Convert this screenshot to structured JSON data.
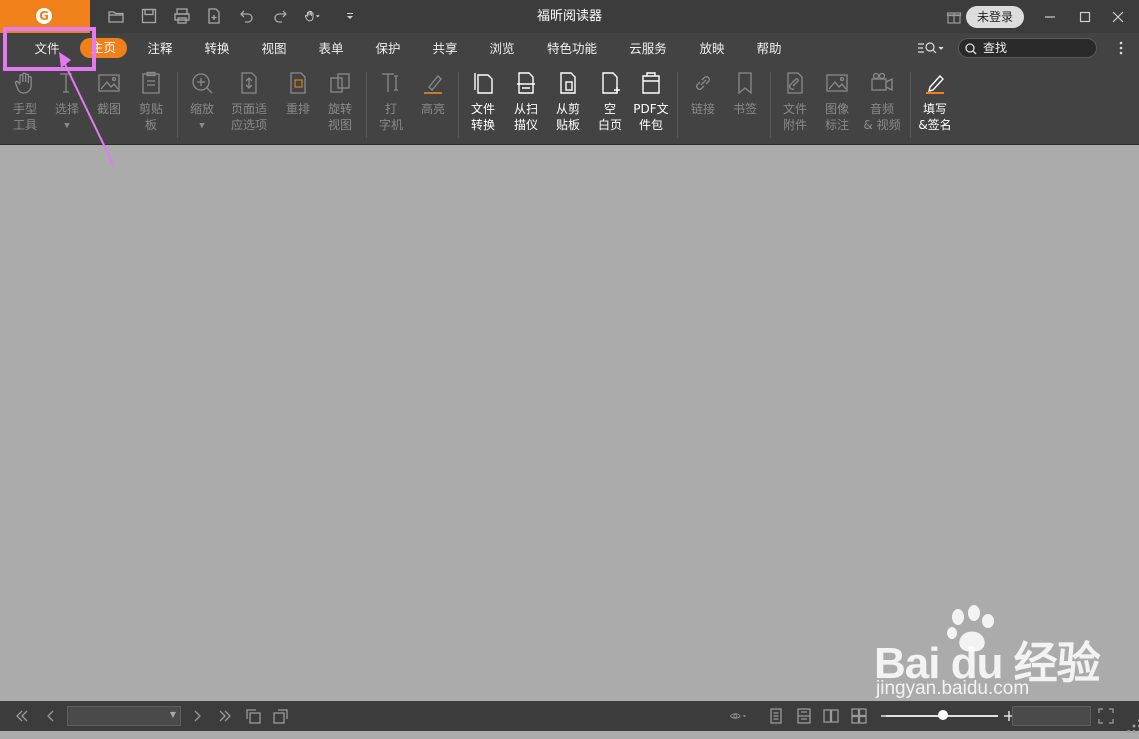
{
  "window": {
    "title": "福昕阅读器",
    "login_label": "未登录"
  },
  "menu": {
    "items": [
      "文件",
      "主页",
      "注释",
      "转换",
      "视图",
      "表单",
      "保护",
      "共享",
      "浏览",
      "特色功能",
      "云服务",
      "放映",
      "帮助"
    ],
    "active": "主页"
  },
  "search": {
    "placeholder": "查找"
  },
  "ribbon": {
    "hand": "手型\n工具",
    "select": "选择",
    "snapshot": "截图",
    "clipboard": "剪贴\n板",
    "zoom": "缩放",
    "page_fit": "页面适\n应选项",
    "reflow": "重排",
    "rotate": "旋转\n视图",
    "typewriter": "打\n字机",
    "highlight": "高亮",
    "file_convert": "文件\n转换",
    "from_scanner": "从扫\n描仪",
    "from_clipboard": "从剪\n贴板",
    "blank_page": "空\n白页",
    "pdf_portfolio": "PDF文\n件包",
    "link": "链接",
    "bookmark": "书签",
    "file_attach": "文件\n附件",
    "image_annot": "图像\n标注",
    "audio_video": "音频\n& 视频",
    "fill_sign": "填写\n&签名"
  },
  "watermark": {
    "brand": "Bai du 经验",
    "url": "jingyan.baidu.com"
  },
  "colors": {
    "accent": "#f0801a",
    "annotation": "#e37bf0",
    "titlebar": "#3c3c3c",
    "ribbon": "#434343",
    "document_bg": "#ababab"
  }
}
